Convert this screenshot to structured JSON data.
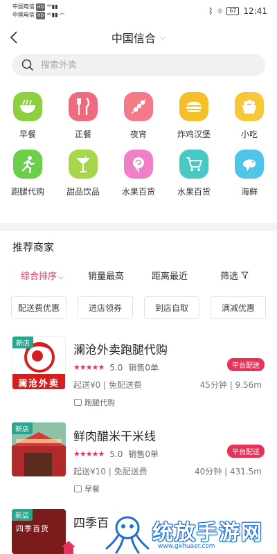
{
  "statusbar": {
    "carrier1": "中国电信",
    "carrier2": "中国电信",
    "hd": "HD",
    "battery": "67",
    "time": "12:41"
  },
  "nav": {
    "title": "中国信合"
  },
  "search": {
    "placeholder": "搜索外卖"
  },
  "categories": [
    {
      "label": "早餐",
      "icon": "noodle-bowl-icon",
      "color": "#8dcf3f"
    },
    {
      "label": "正餐",
      "icon": "fork-knife-icon",
      "color": "#f06a7e"
    },
    {
      "label": "夜宵",
      "icon": "skewer-icon",
      "color": "#f47a88"
    },
    {
      "label": "炸鸡汉堡",
      "icon": "burger-icon",
      "color": "#f5bf2a"
    },
    {
      "label": "小吃",
      "icon": "snack-icon",
      "color": "#f7c73a"
    },
    {
      "label": "跑腿代购",
      "icon": "runner-icon",
      "color": "#6ccf4a"
    },
    {
      "label": "甜品饮品",
      "icon": "cocktail-icon",
      "color": "#a6d64a"
    },
    {
      "label": "水果百货",
      "icon": "rose-icon",
      "color": "#ee7fc8"
    },
    {
      "label": "水果百货",
      "icon": "cart-icon",
      "color": "#48c9c4"
    },
    {
      "label": "海鲜",
      "icon": "shrimp-icon",
      "color": "#4fc6e8"
    }
  ],
  "section": {
    "title": "推荐商家"
  },
  "sort": {
    "composite": "综合排序",
    "sales": "销量最高",
    "distance": "距离最近",
    "filter": "筛选"
  },
  "chips": [
    "配送费优惠",
    "进店领券",
    "到店自取",
    "满减优惠"
  ],
  "shops": [
    {
      "new_tag": "新店",
      "name": "澜沧外卖跑腿代购",
      "rating": "5.0",
      "sales": "销售0单",
      "badge": "平台配送",
      "fees": "起送¥0 | 免配送费",
      "eta": "45分钟 | 9.56m",
      "tag": "跑腿代购",
      "logo_text": "澜沧外卖"
    },
    {
      "new_tag": "新店",
      "name": "鲜肉醋米干米线",
      "rating": "5.0",
      "sales": "销售0单",
      "badge": "平台配送",
      "fees": "起送¥10 | 免配送费",
      "eta": "40分钟 | 431.5m",
      "tag": "早餐"
    },
    {
      "new_tag": "新店",
      "name": "四季百",
      "logo_text": "四季百货"
    }
  ],
  "watermark": {
    "text": "统放手游网",
    "url": "www.gxhuaer.com"
  },
  "colors": {
    "accent": "#e6335a",
    "new_tag": "#2aa58d"
  }
}
